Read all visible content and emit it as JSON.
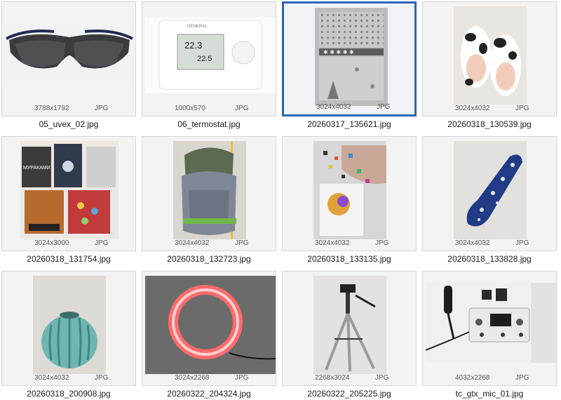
{
  "files": [
    {
      "name": "05_uvex_02.jpg",
      "dims": "3788x1792",
      "type": "JPG",
      "thumb_icon": "safety-glasses-photo"
    },
    {
      "name": "06_termostat.jpg",
      "dims": "1000x570",
      "type": "JPG",
      "thumb_icon": "thermostat-photo",
      "brand": "GENERAL",
      "temp1": "22.3",
      "temp2": "22.5"
    },
    {
      "name": "20260317_135621.jpg",
      "dims": "3024x4032",
      "type": "JPG",
      "thumb_icon": "patterned-blanket-photo",
      "selected": true
    },
    {
      "name": "20260318_130539.jpg",
      "dims": "3024x4032",
      "type": "JPG",
      "thumb_icon": "cow-slippers-photo"
    },
    {
      "name": "20260318_131754.jpg",
      "dims": "3024x3000",
      "type": "JPG",
      "thumb_icon": "books-photo",
      "book_title": "МУРАКАМИ"
    },
    {
      "name": "20260318_132723.jpg",
      "dims": "3024x4032",
      "type": "JPG",
      "thumb_icon": "backpack-photo"
    },
    {
      "name": "20260318_133135.jpg",
      "dims": "3024x4032",
      "type": "JPG",
      "thumb_icon": "puzzle-photo"
    },
    {
      "name": "20260318_133828.jpg",
      "dims": "3024x4032",
      "type": "JPG",
      "thumb_icon": "floral-pillow-photo"
    },
    {
      "name": "20260318_200908.jpg",
      "dims": "3024x4032",
      "type": "JPG",
      "thumb_icon": "ceramic-vase-photo"
    },
    {
      "name": "20260322_204324.jpg",
      "dims": "3024x2268",
      "type": "JPG",
      "thumb_icon": "ring-light-photo"
    },
    {
      "name": "20260322_205225.jpg",
      "dims": "2268x3024",
      "type": "JPG",
      "thumb_icon": "tripod-photo"
    },
    {
      "name": "tc_gtx_mic_01.jpg",
      "dims": "4032x2268",
      "type": "JPG",
      "thumb_icon": "microphone-mixer-photo"
    }
  ],
  "colors": {
    "selection_border": "#2f64b5",
    "tile_background": "#f3f3f3",
    "tile_border": "#d6d6d6"
  }
}
